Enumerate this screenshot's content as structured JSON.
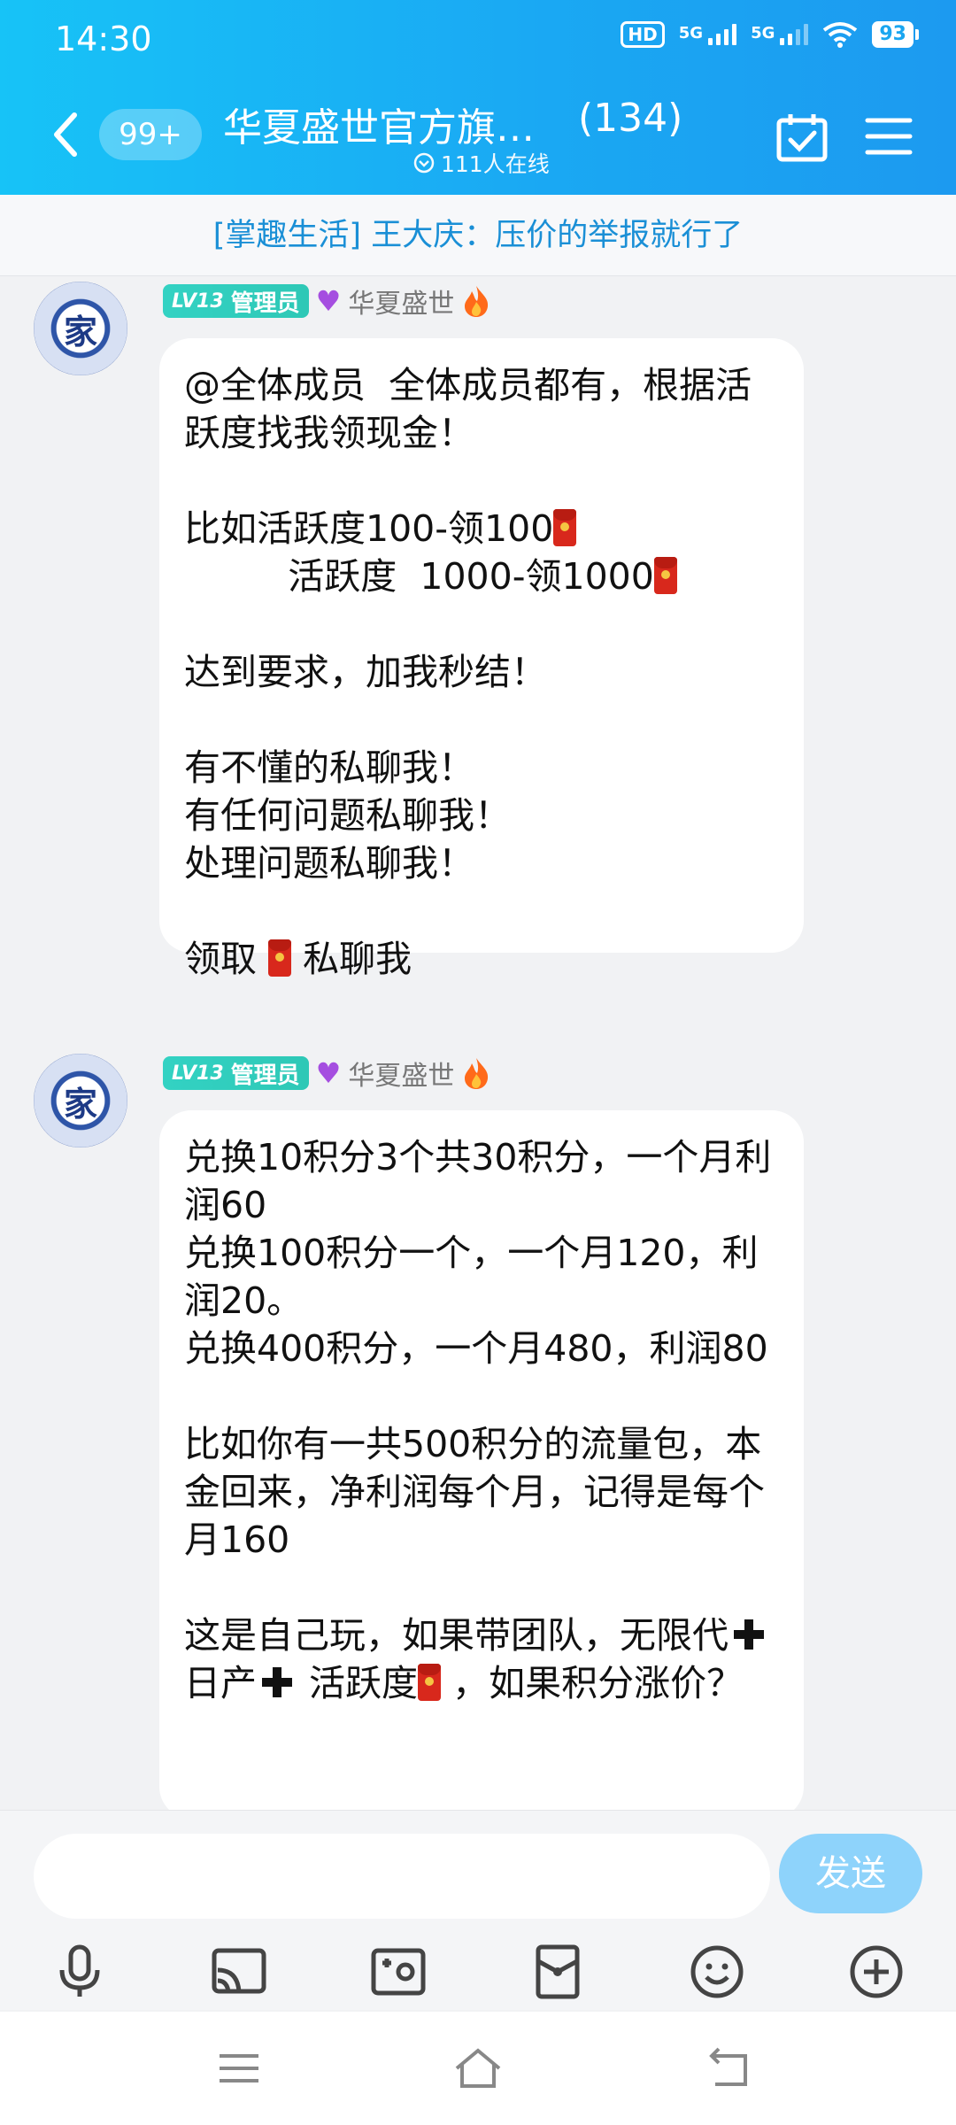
{
  "status": {
    "time": "14:30",
    "hd": "HD",
    "net1": "5G",
    "net2": "5G",
    "battery": "93"
  },
  "header": {
    "unread_badge": "99+",
    "title": "华夏盛世官方旗…",
    "member_count": "(134)",
    "online": "111人在线"
  },
  "announcement": "[掌趣生活]  王大庆：压价的举报就行了",
  "messages": [
    {
      "avatar_char": "家",
      "level": "LV13",
      "role": "管理员",
      "sender": "华夏盛世",
      "lines": [
        "@全体成员  全体成员都有，根据活跃度找我领现金！",
        "",
        "比如活跃度100-领100",
        "         活跃度  1000-领1000",
        "",
        "达到要求，加我秒结！",
        "",
        "有不懂的私聊我！",
        "有任何问题私聊我！",
        "处理问题私聊我！",
        "",
        "领取",
        "私聊我"
      ]
    },
    {
      "avatar_char": "家",
      "level": "LV13",
      "role": "管理员",
      "sender": "华夏盛世",
      "lines": [
        "兑换10积分3个共30积分，一个月利润60",
        "兑换100积分一个，一个月120，利润20。",
        "兑换400积分，一个月480，利润80",
        "",
        "比如你有一共500积分的流量包，本金回来，净利润每个月，记得是每个月160",
        "",
        "这是自己玩，如果带团队，无限代",
        "日产",
        "活跃度",
        "，如果积分涨价？"
      ]
    }
  ],
  "composer": {
    "placeholder": "",
    "send_label": "发送"
  },
  "colors": {
    "header_gradient_start": "#17c3f7",
    "header_gradient_end": "#1c9af0",
    "announcement_text": "#1a8fd6",
    "level_badge": "#33d2c3",
    "send_button": "#8ed3fb"
  },
  "icons": {
    "toolbar": [
      "microphone-icon",
      "screen-cast-icon",
      "photo-icon",
      "red-packet-icon",
      "emoji-icon",
      "plus-circle-icon"
    ],
    "navigation": [
      "menu-lines-icon",
      "home-icon",
      "back-icon"
    ]
  }
}
